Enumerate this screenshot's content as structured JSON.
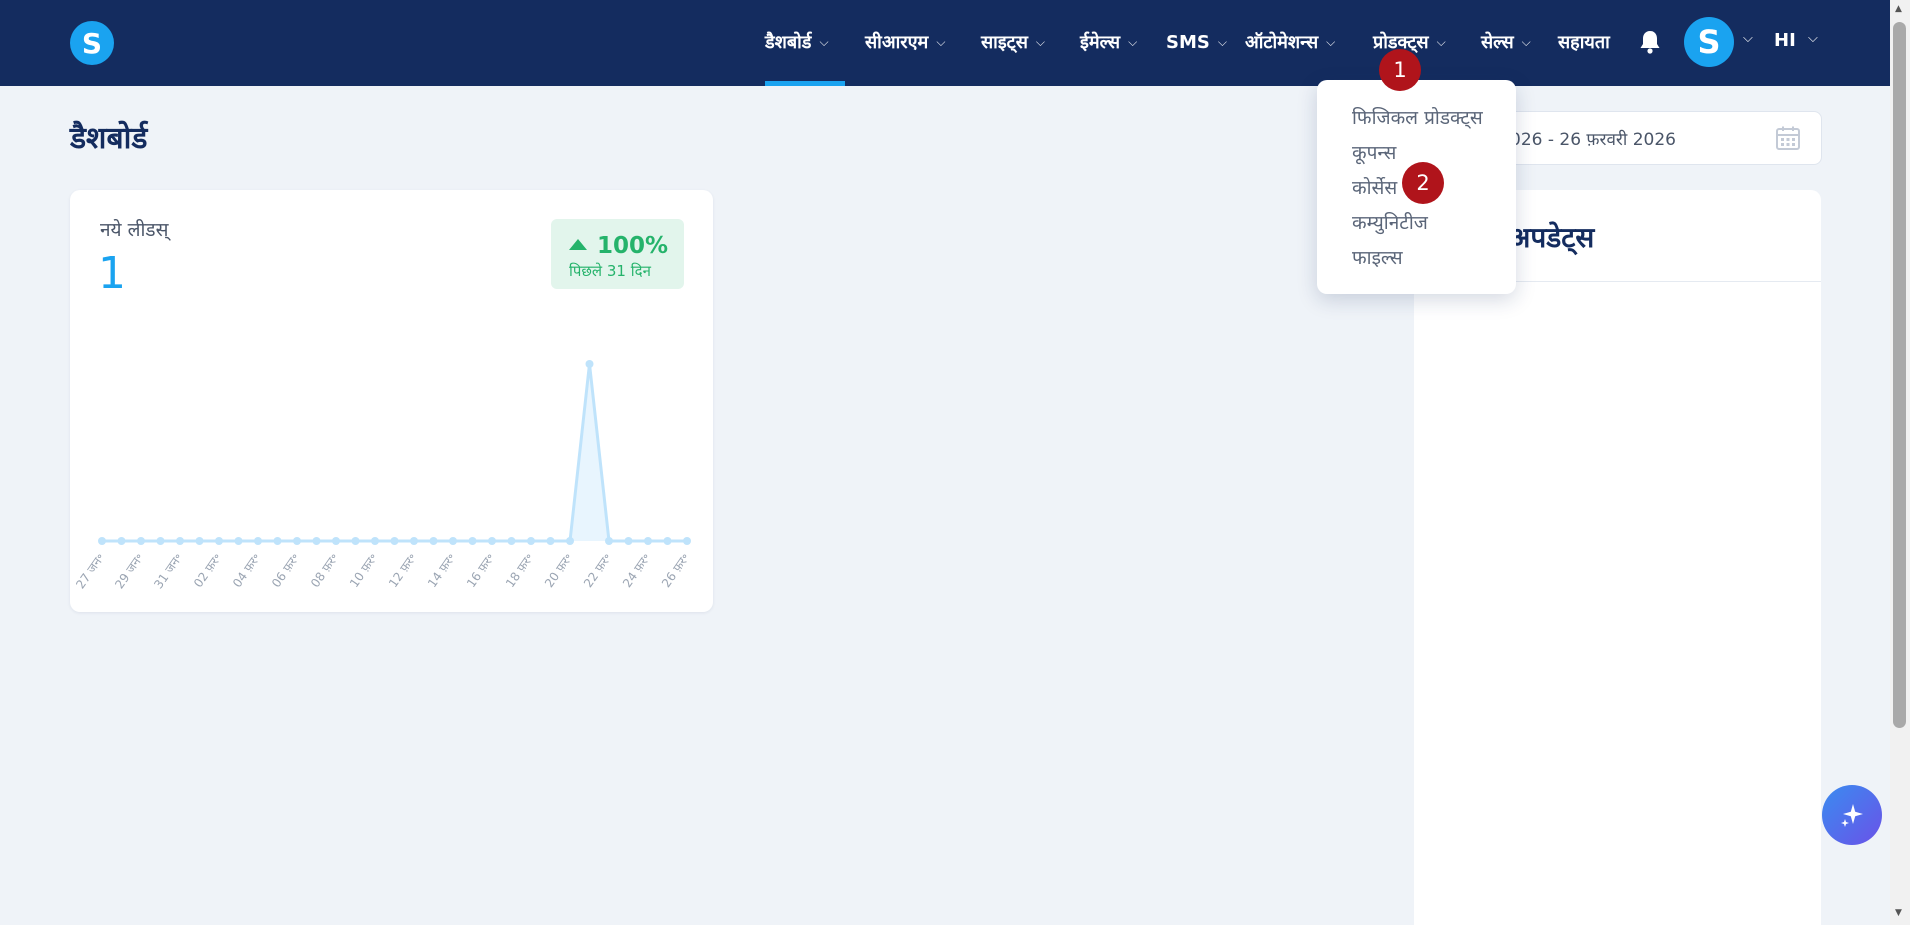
{
  "topbar": {
    "logo_letter": "S",
    "nav": [
      {
        "label": "डैशबोर्ड",
        "has_chevron": true,
        "active": true
      },
      {
        "label": "सीआरएम",
        "has_chevron": true
      },
      {
        "label": "साइट्स",
        "has_chevron": true
      },
      {
        "label": "ईमेल्स",
        "has_chevron": true
      },
      {
        "label": "SMS",
        "has_chevron": false
      },
      {
        "label": "ऑटोमेशन्स",
        "has_chevron": true
      },
      {
        "label": "प्रोडक्ट्स",
        "has_chevron": true
      },
      {
        "label": "सेल्स",
        "has_chevron": true
      },
      {
        "label": "सहायता",
        "has_chevron": false
      }
    ],
    "chevron_glyph": "⌄",
    "notification_icon": "bell-icon",
    "avatar_letter": "S",
    "language": "HI",
    "accent_color": "#1aa3f0",
    "bg_color": "#142c5f"
  },
  "page": {
    "title": "डैशबोर्ड",
    "date_range": "026 - 26 फ़रवरी 2026",
    "calendar_icon": "calendar-icon"
  },
  "leads_card": {
    "label": "नये लीडस्",
    "value": "1",
    "change_pct": "100%",
    "change_period": "पिछले 31 दिन",
    "trend_icon": "triangle-up-icon",
    "positive_color": "#25b36b"
  },
  "chart_data": {
    "type": "area",
    "title": "",
    "xlabel": "",
    "ylabel": "",
    "x": [
      "27 जन॰",
      "28 जन॰",
      "29 जन॰",
      "30 जन॰",
      "31 जन॰",
      "01 फ़र॰",
      "02 फ़र॰",
      "03 फ़र॰",
      "04 फ़र॰",
      "05 फ़र॰",
      "06 फ़र॰",
      "07 फ़र॰",
      "08 फ़र॰",
      "09 फ़र॰",
      "10 फ़र॰",
      "11 फ़र॰",
      "12 फ़र॰",
      "13 फ़र॰",
      "14 फ़र॰",
      "15 फ़र॰",
      "16 फ़र॰",
      "17 फ़र॰",
      "18 फ़र॰",
      "19 फ़र॰",
      "20 फ़र॰",
      "21 फ़र॰",
      "22 फ़र॰",
      "23 फ़र॰",
      "24 फ़र॰",
      "25 फ़र॰",
      "26 फ़र॰"
    ],
    "tick_labels": [
      "27 जन॰",
      "29 जन॰",
      "31 जन॰",
      "02 फ़र॰",
      "04 फ़र॰",
      "06 फ़र॰",
      "08 फ़र॰",
      "10 फ़र॰",
      "12 फ़र॰",
      "14 फ़र॰",
      "16 फ़र॰",
      "18 फ़र॰",
      "20 फ़र॰",
      "22 फ़र॰",
      "24 फ़र॰",
      "26 फ़र॰"
    ],
    "series": [
      {
        "values": [
          0,
          0,
          0,
          0,
          0,
          0,
          0,
          0,
          0,
          0,
          0,
          0,
          0,
          0,
          0,
          0,
          0,
          0,
          0,
          0,
          0,
          0,
          0,
          0,
          0,
          1,
          0,
          0,
          0,
          0,
          0
        ]
      }
    ],
    "ylim": [
      0,
      1
    ],
    "grid": false,
    "line_color": "#bfe3fb",
    "fill_color": "#e8f5fe"
  },
  "updates_card": {
    "title": "अपडेट्स"
  },
  "products_dropdown": {
    "items": [
      "फिजिकल प्रोडक्ट्स",
      "कूपन्स",
      "कोर्सेस",
      "कम्युनिटीज",
      "फाइल्स"
    ]
  },
  "markers": [
    "1",
    "2"
  ],
  "ai_button_icon": "sparkle-icon"
}
